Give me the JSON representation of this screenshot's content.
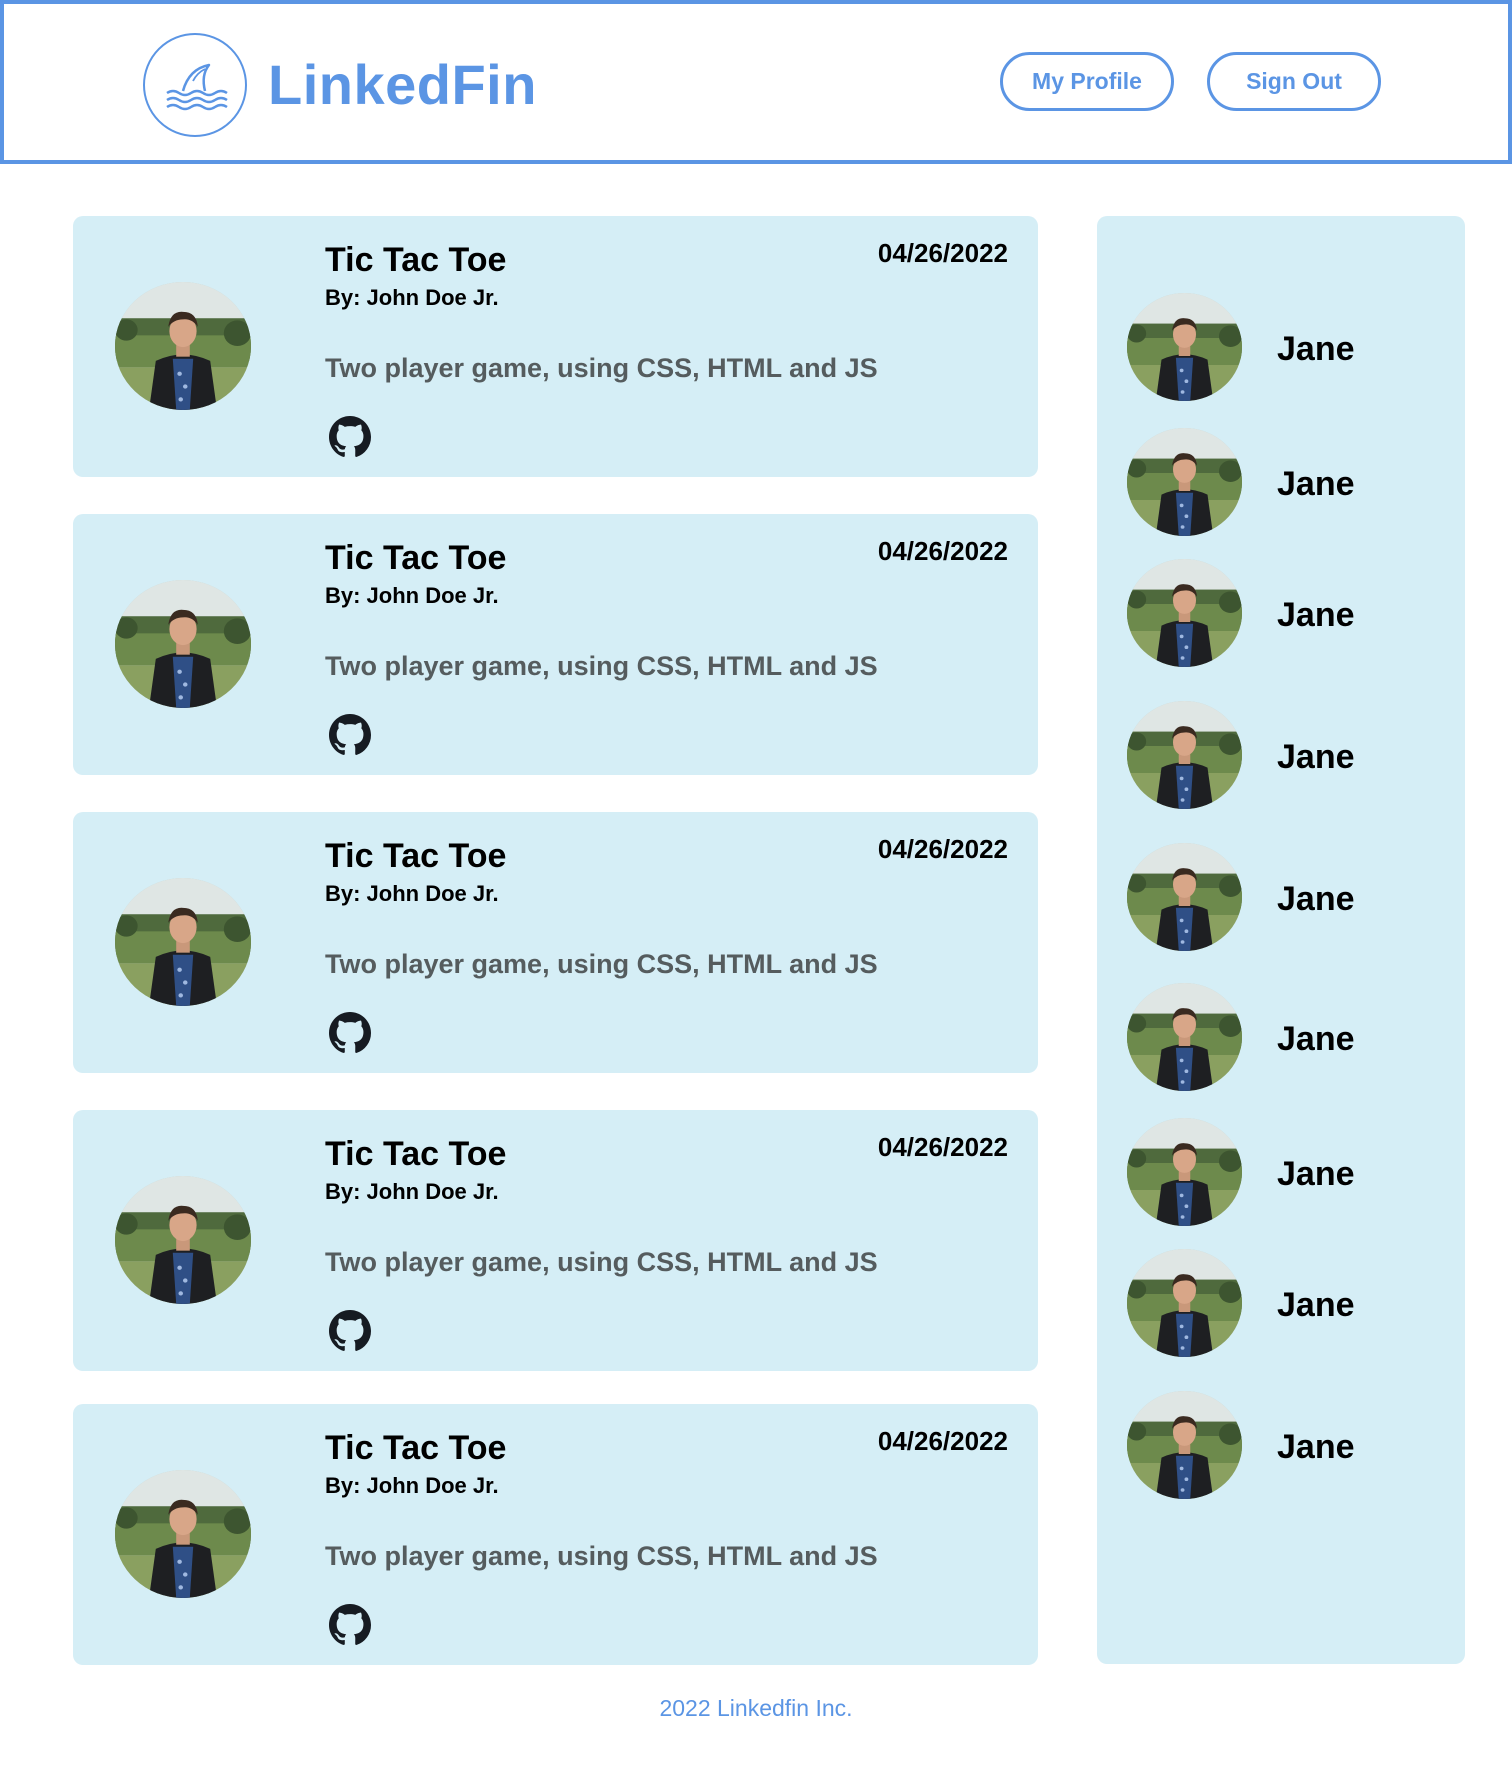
{
  "header": {
    "brand": "LinkedFin",
    "logo_icon": "shark-fin-waves-icon",
    "nav": {
      "my_profile_label": "My Profile",
      "sign_out_label": "Sign Out"
    }
  },
  "colors": {
    "accent": "#5b95e4",
    "card_background": "#d5eef6",
    "description_text": "#555c5e"
  },
  "projects": [
    {
      "title": "Tic Tac Toe",
      "author": "By: John Doe Jr.",
      "date": "04/26/2022",
      "description": "Two player game, using CSS, HTML and JS",
      "link_icon": "github-icon"
    },
    {
      "title": "Tic Tac Toe",
      "author": "By: John Doe Jr.",
      "date": "04/26/2022",
      "description": "Two player game, using CSS, HTML and JS",
      "link_icon": "github-icon"
    },
    {
      "title": "Tic Tac Toe",
      "author": "By: John Doe Jr.",
      "date": "04/26/2022",
      "description": "Two player game, using CSS, HTML and JS",
      "link_icon": "github-icon"
    },
    {
      "title": "Tic Tac Toe",
      "author": "By: John Doe Jr.",
      "date": "04/26/2022",
      "description": "Two player game, using CSS, HTML and JS",
      "link_icon": "github-icon"
    },
    {
      "title": "Tic Tac Toe",
      "author": "By: John Doe Jr.",
      "date": "04/26/2022",
      "description": "Two player game, using CSS, HTML and JS",
      "link_icon": "github-icon"
    }
  ],
  "sidebar": {
    "friends": [
      {
        "name": "Jane"
      },
      {
        "name": "Jane"
      },
      {
        "name": "Jane"
      },
      {
        "name": "Jane"
      },
      {
        "name": "Jane"
      },
      {
        "name": "Jane"
      },
      {
        "name": "Jane"
      },
      {
        "name": "Jane"
      },
      {
        "name": "Jane"
      }
    ]
  },
  "footer": {
    "text": "2022 Linkedfin Inc."
  }
}
